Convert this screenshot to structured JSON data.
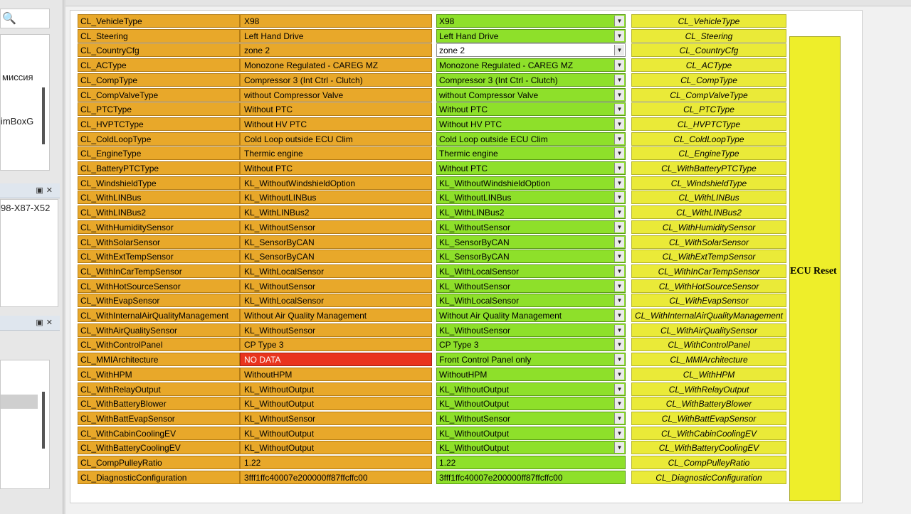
{
  "left_panel": {
    "text_1": "миссия",
    "text_2": "imBoxG",
    "text_3": "98-X87-X52"
  },
  "reset_button_label": "ECU Reset",
  "rows": [
    {
      "name": "CL_VehicleType",
      "value": "X98",
      "selected": "X98",
      "label": "CL_VehicleType"
    },
    {
      "name": "CL_Steering",
      "value": "Left Hand Drive",
      "selected": "Left Hand Drive",
      "label": "CL_Steering"
    },
    {
      "name": "CL_CountryCfg",
      "value": "zone 2",
      "selected": "zone 2",
      "label": "CL_CountryCfg",
      "white": true
    },
    {
      "name": "CL_ACType",
      "value": "Monozone Regulated -  CAREG MZ",
      "selected": "Monozone Regulated -  CAREG MZ",
      "label": "CL_ACType"
    },
    {
      "name": "CL_CompType",
      "value": "Compressor 3 (Int Ctrl - Clutch)",
      "selected": "Compressor 3 (Int Ctrl - Clutch)",
      "label": "CL_CompType"
    },
    {
      "name": "CL_CompValveType",
      "value": "without Compressor Valve",
      "selected": "without Compressor Valve",
      "label": "CL_CompValveType"
    },
    {
      "name": "CL_PTCType",
      "value": "Without PTC",
      "selected": "Without PTC",
      "label": "CL_PTCType"
    },
    {
      "name": "CL_HVPTCType",
      "value": "Without HV PTC",
      "selected": "Without HV PTC",
      "label": "CL_HVPTCType"
    },
    {
      "name": "CL_ColdLoopType",
      "value": "Cold Loop outside ECU Clim",
      "selected": "Cold Loop outside ECU Clim",
      "label": "CL_ColdLoopType"
    },
    {
      "name": "CL_EngineType",
      "value": "Thermic engine",
      "selected": "Thermic engine",
      "label": "CL_EngineType"
    },
    {
      "name": "CL_BatteryPTCType",
      "value": "Without PTC",
      "selected": "Without PTC",
      "label": "CL_WithBatteryPTCType"
    },
    {
      "name": "CL_WindshieldType",
      "value": "KL_WithoutWindshieldOption",
      "selected": "KL_WithoutWindshieldOption",
      "label": "CL_WindshieldType"
    },
    {
      "name": "CL_WithLINBus",
      "value": "KL_WithoutLINBus",
      "selected": "KL_WithoutLINBus",
      "label": "CL_WithLINBus"
    },
    {
      "name": "CL_WithLINBus2",
      "value": "KL_WithLINBus2",
      "selected": "KL_WithLINBus2",
      "label": "CL_WithLINBus2"
    },
    {
      "name": "CL_WithHumiditySensor",
      "value": "KL_WithoutSensor",
      "selected": "KL_WithoutSensor",
      "label": "CL_WithHumiditySensor"
    },
    {
      "name": "CL_WithSolarSensor",
      "value": "KL_SensorByCAN",
      "selected": "KL_SensorByCAN",
      "label": "CL_WithSolarSensor"
    },
    {
      "name": "CL_WithExtTempSensor",
      "value": "KL_SensorByCAN",
      "selected": "KL_SensorByCAN",
      "label": "CL_WithExtTempSensor"
    },
    {
      "name": "CL_WithInCarTempSensor",
      "value": "KL_WithLocalSensor",
      "selected": "KL_WithLocalSensor",
      "label": "CL_WithInCarTempSensor"
    },
    {
      "name": "CL_WithHotSourceSensor",
      "value": "KL_WithoutSensor",
      "selected": "KL_WithoutSensor",
      "label": "CL_WithHotSourceSensor"
    },
    {
      "name": "CL_WithEvapSensor",
      "value": "KL_WithLocalSensor",
      "selected": "KL_WithLocalSensor",
      "label": "CL_WithEvapSensor"
    },
    {
      "name": "CL_WithInternalAirQualityManagement",
      "value": "Without Air Quality Management",
      "selected": "Without Air Quality Management",
      "label": "CL_WithInternalAirQualityManagement"
    },
    {
      "name": "CL_WithAirQualitySensor",
      "value": "KL_WithoutSensor",
      "selected": "KL_WithoutSensor",
      "label": "CL_WithAirQualitySensor"
    },
    {
      "name": "CL_WithControlPanel",
      "value": "CP Type 3",
      "selected": "CP Type 3",
      "label": "CL_WithControlPanel"
    },
    {
      "name": "CL_MMIArchitecture",
      "value": "NO DATA",
      "selected": "Front Control Panel only",
      "label": "CL_MMIArchitecture",
      "nodata": true
    },
    {
      "name": "CL_WithHPM",
      "value": "WithoutHPM",
      "selected": "WithoutHPM",
      "label": "CL_WithHPM"
    },
    {
      "name": "CL_WithRelayOutput",
      "value": "KL_WithoutOutput",
      "selected": "KL_WithoutOutput",
      "label": "CL_WithRelayOutput"
    },
    {
      "name": "CL_WithBatteryBlower",
      "value": "KL_WithoutOutput",
      "selected": "KL_WithoutOutput",
      "label": "CL_WithBatteryBlower"
    },
    {
      "name": "CL_WithBattEvapSensor",
      "value": "KL_WithoutSensor",
      "selected": "KL_WithoutSensor",
      "label": "CL_WithBattEvapSensor"
    },
    {
      "name": "CL_WithCabinCoolingEV",
      "value": "KL_WithoutOutput",
      "selected": "KL_WithoutOutput",
      "label": "CL_WithCabinCoolingEV"
    },
    {
      "name": "CL_WithBatteryCoolingEV",
      "value": "KL_WithoutOutput",
      "selected": "KL_WithoutOutput",
      "label": "CL_WithBatteryCoolingEV"
    },
    {
      "name": "CL_CompPulleyRatio",
      "value": "1.22",
      "selected": "1.22",
      "label": "CL_CompPulleyRatio",
      "nodrop": true
    },
    {
      "name": "CL_DiagnosticConfiguration",
      "value": "3fff1ffc40007e200000ff87ffcffc00",
      "selected": "3fff1ffc40007e200000ff87ffcffc00",
      "label": "CL_DiagnosticConfiguration",
      "nodrop": true
    }
  ]
}
